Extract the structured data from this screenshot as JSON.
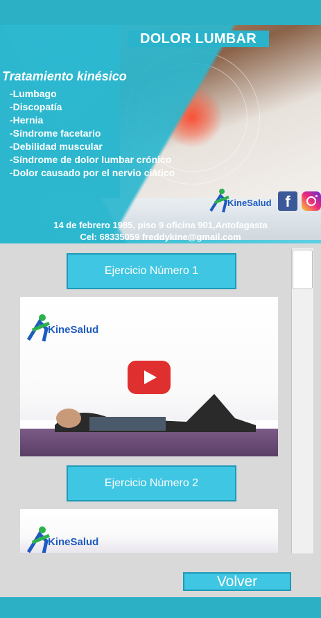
{
  "banner": {
    "title": "DOLOR LUMBAR",
    "subtitle": "Tratamiento kinésico",
    "conditions": [
      "-Lumbago",
      "-Discopatía",
      "-Hernia",
      "-Síndrome facetario",
      "-Debilidad muscular",
      "-Síndrome de dolor lumbar crónico",
      "-Dolor causado por el nervio ciático"
    ],
    "brand": "KineSalud",
    "address": "14 de febrero 1985, piso 9 oficina 901,Antofagasta",
    "contact": "Cel: 68335059 freddykine@gmail.com",
    "social_icons": [
      "facebook-icon",
      "instagram-icon"
    ]
  },
  "exercises": [
    {
      "label": "Ejercicio Número 1",
      "brand": "KineSalud",
      "icon": "youtube-play-icon"
    },
    {
      "label": "Ejercicio Número 2",
      "brand": "KineSalud"
    }
  ],
  "volver_label": "Volver",
  "colors": {
    "accent": "#2cb0c6",
    "button": "#3fc6e2",
    "button_border": "#1c9ab7",
    "play": "#e02f2f"
  }
}
